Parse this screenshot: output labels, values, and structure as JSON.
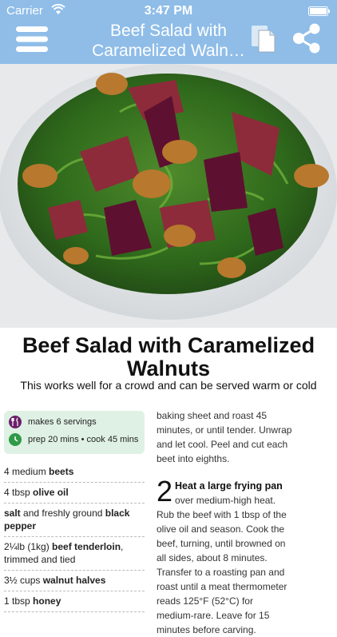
{
  "status_bar": {
    "carrier": "Carrier",
    "time": "3:47 PM"
  },
  "header": {
    "title_line1": "Beef Salad with",
    "title_line2": "Caramelized Waln…",
    "background": "#8fbde8",
    "icons": [
      "menu-icon",
      "document-copy-icon",
      "share-icon"
    ]
  },
  "recipe": {
    "title": "Beef Salad with Caramelized Walnuts",
    "subtitle": "This works well for a crowd and can be served warm or cold",
    "servings": "makes 6 servings",
    "times": "prep 20 mins • cook 45 mins",
    "ingredients": [
      {
        "pre": "4 medium ",
        "bold": "beets",
        "post": ""
      },
      {
        "pre": "4 tbsp ",
        "bold": "olive oil",
        "post": ""
      },
      {
        "pre": "",
        "bold": "salt",
        "mid": " and freshly ground ",
        "bold2": "black pepper"
      },
      {
        "pre": "2¼lb (1kg) ",
        "bold": "beef tenderloin",
        "post": ", trimmed and tied"
      },
      {
        "pre": "3½ cups ",
        "bold": "walnut halves",
        "post": ""
      },
      {
        "pre": "1 tbsp ",
        "bold": "honey",
        "post": ""
      }
    ],
    "method_continued": "baking sheet and roast 45 minutes, or until tender. Unwrap and let cool. Peel and cut each beet into eighths.",
    "step2_number": "2",
    "step2_heading": "Heat a large frying pan",
    "step2_text": " over medium-high heat. Rub the beef with 1 tbsp of the olive oil and season. Cook the beef, turning, until browned on all sides, about 8 minutes. Transfer to a roasting pan and roast until a meat thermometer reads 125°F (52°C) for medium-rare. Leave for 15 minutes before carving."
  }
}
